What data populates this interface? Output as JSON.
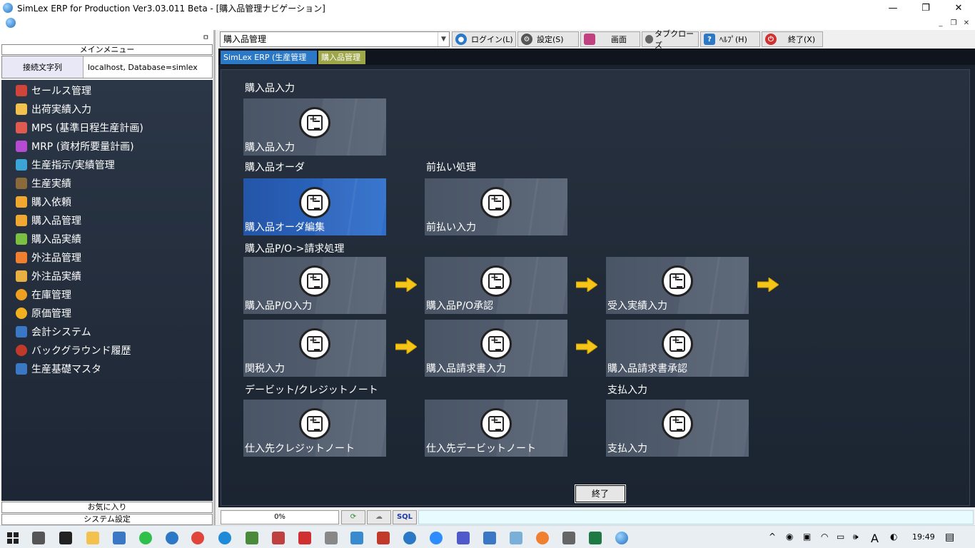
{
  "window": {
    "title": "SimLex ERP for Production Ver3.03.011 Beta - [購入品管理ナビゲーション]",
    "minimize": "—",
    "restore": "❐",
    "close": "✕"
  },
  "left": {
    "pin": "ㅁ",
    "menu_header": "メインメニュー",
    "conn_label": "接続文字列",
    "conn_value": "localhost,  Database=simlex",
    "items": [
      {
        "label": "セールス管理",
        "color": "#d0443a"
      },
      {
        "label": "出荷実績入力",
        "color": "#f2c14e"
      },
      {
        "label": "MPS (基準日程生産計画)",
        "color": "#e05a4f"
      },
      {
        "label": "MRP (資材所要量計画)",
        "color": "#b54bd0"
      },
      {
        "label": "生産指示/実績管理",
        "color": "#3aa5d6"
      },
      {
        "label": "生産実績",
        "color": "#8a6a3a"
      },
      {
        "label": "購入依頼",
        "color": "#f0a830"
      },
      {
        "label": "購入品管理",
        "color": "#f0a830"
      },
      {
        "label": "購入品実績",
        "color": "#7bc043"
      },
      {
        "label": "外注品管理",
        "color": "#f08030"
      },
      {
        "label": "外注品実績",
        "color": "#e8b040"
      },
      {
        "label": "在庫管理",
        "color": "#f0a020"
      },
      {
        "label": "原価管理",
        "color": "#f0b020"
      },
      {
        "label": "会計システム",
        "color": "#3a78c6"
      },
      {
        "label": "バックグラウンド履歴",
        "color": "#c0392b"
      },
      {
        "label": "生産基礎マスタ",
        "color": "#3a78c6"
      }
    ],
    "favorites": "お気に入り",
    "system_settings": "システム設定"
  },
  "toolbar": {
    "combo_value": "購入品管理",
    "buttons": [
      {
        "label": "ログイン(L)",
        "icon": "login-icon",
        "color": "#2a78c6"
      },
      {
        "label": "設定(S)",
        "icon": "gear-icon",
        "color": "#555555"
      },
      {
        "label": "画面",
        "icon": "screen-icon",
        "color": "#c04080"
      },
      {
        "label": "タブクローズ",
        "icon": "tab-close-icon",
        "color": "#666666"
      },
      {
        "label": "ﾍﾙﾌﾟ(H)",
        "icon": "help-icon",
        "color": "#2a78c6"
      },
      {
        "label": "終了(X)",
        "icon": "power-icon",
        "color": "#d03030"
      }
    ]
  },
  "tabs": {
    "tab1": "SimLex ERP (生産管理用)",
    "tab2": "購入品管理"
  },
  "nav": {
    "sections": {
      "s1": "購入品入力",
      "s2": "購入品オーダ",
      "s3": "前払い処理",
      "s4": "購入品P/O->請求処理",
      "s5": "デービット/クレジットノート",
      "s6": "支払入力"
    },
    "tiles": {
      "t1": "購入品入力",
      "t2": "購入品オーダ編集",
      "t3": "前払い入力",
      "t4": "購入品P/O入力",
      "t5": "購入品P/O承認",
      "t6": "受入実績入力",
      "t7": "関税入力",
      "t8": "購入品請求書入力",
      "t9": "購入品請求書承認",
      "t10": "仕入先クレジットノート",
      "t11": "仕入先デービットノート",
      "t12": "支払入力"
    },
    "end_button": "終了"
  },
  "status": {
    "progress_text": "0%",
    "progress": 0,
    "sql": "SQL"
  },
  "taskbar": {
    "time": "19:49"
  }
}
